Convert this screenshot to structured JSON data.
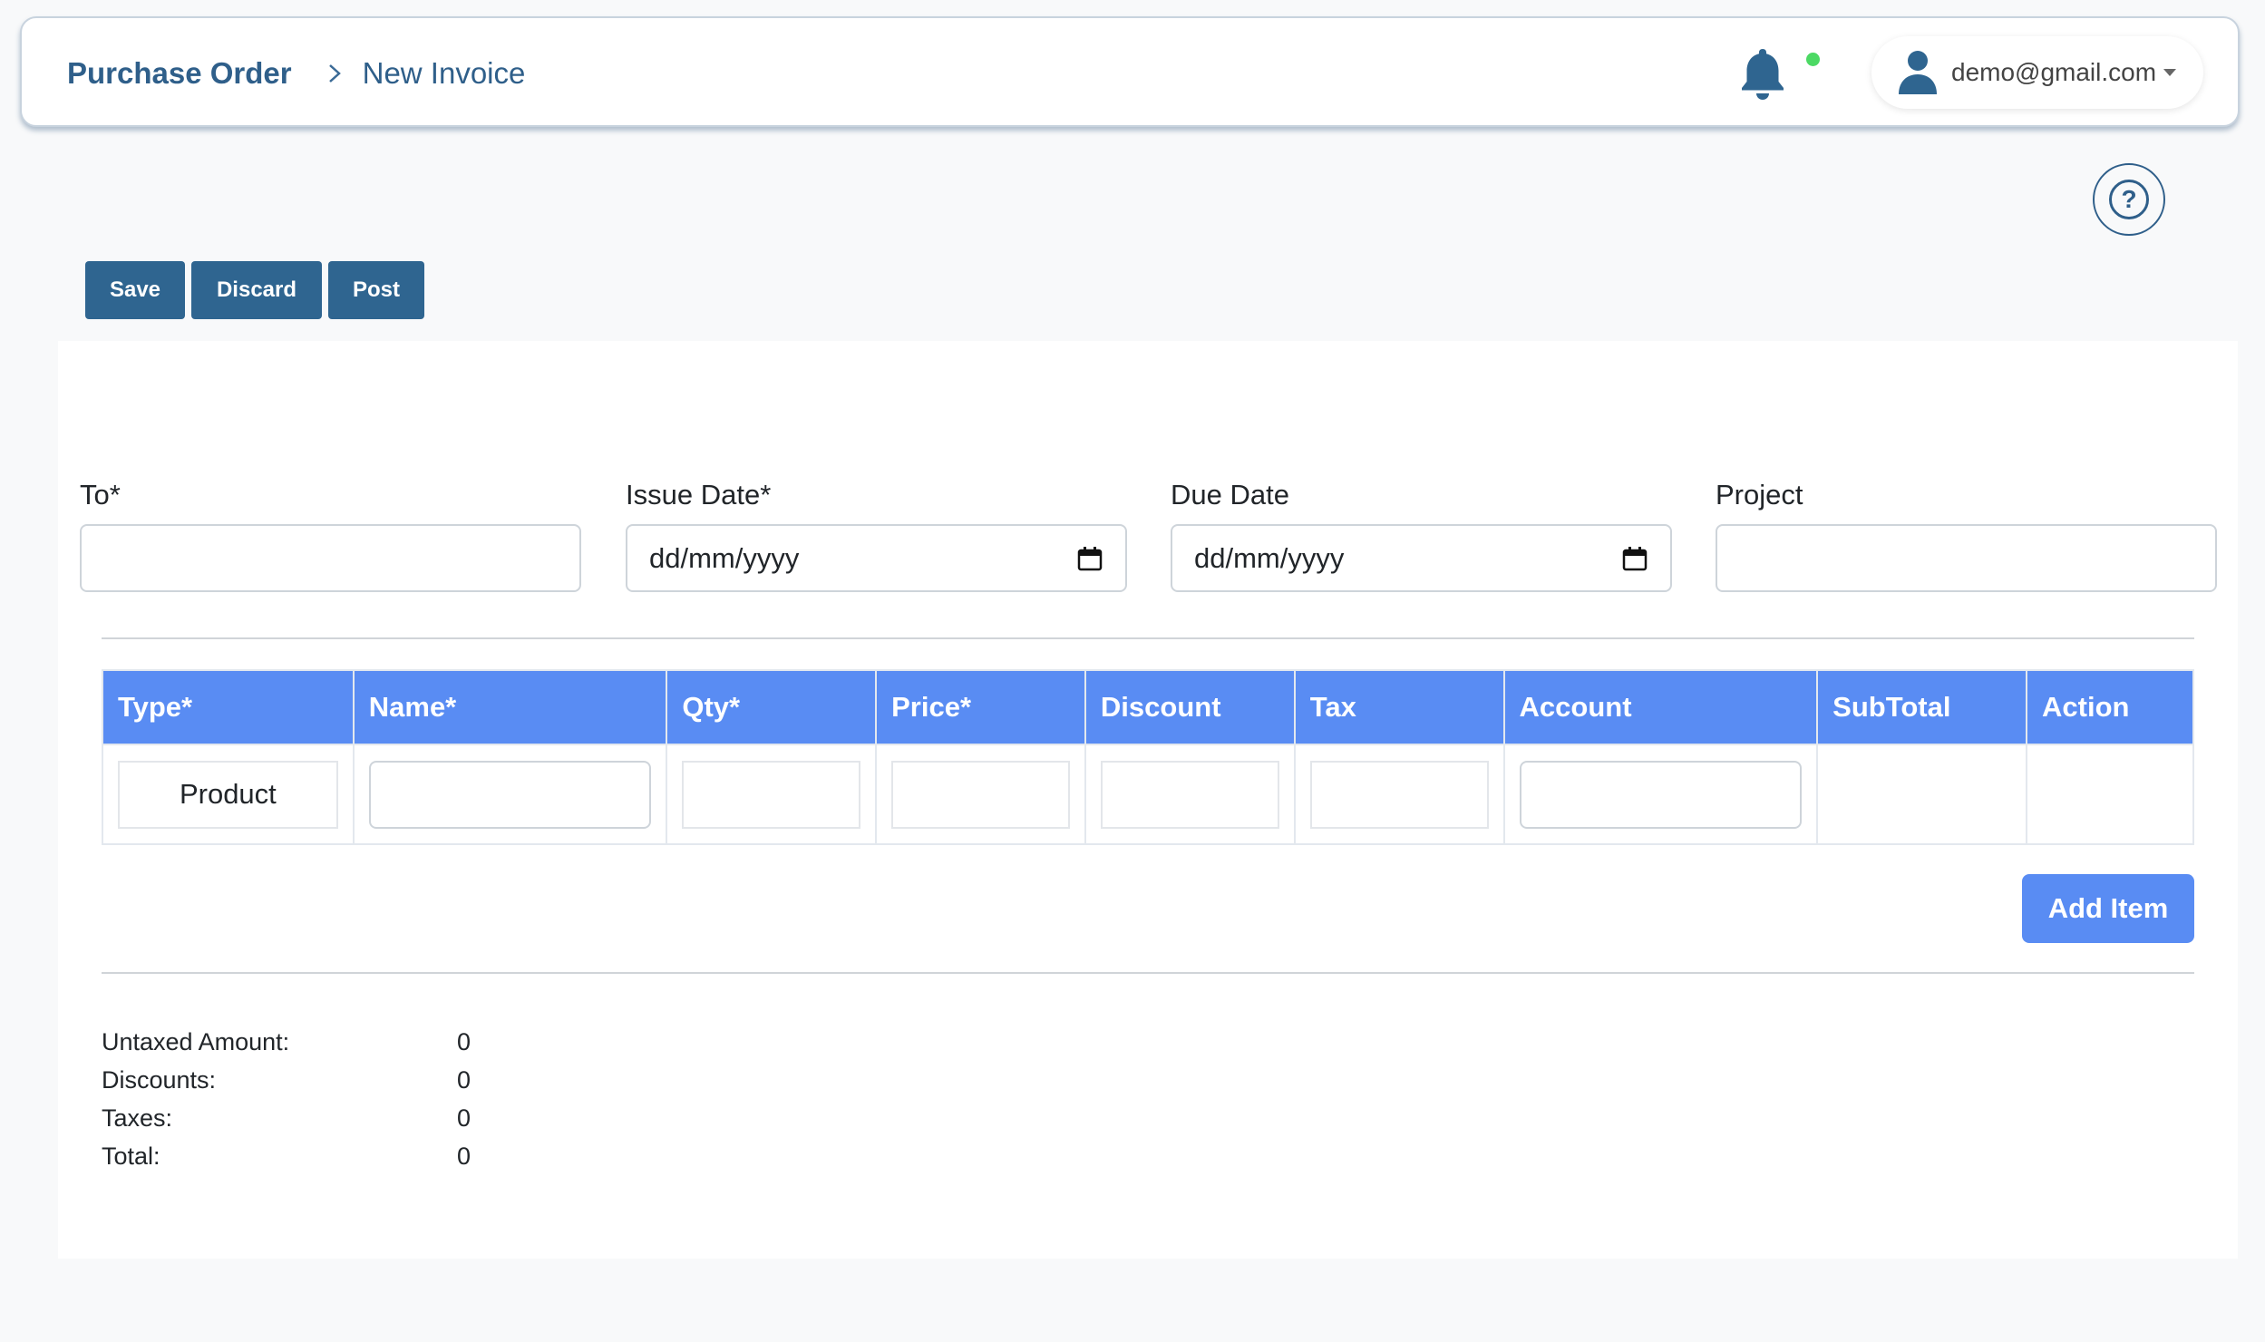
{
  "header": {
    "breadcrumb_root": "Purchase Order",
    "breadcrumb_current": "New Invoice",
    "user_email": "demo@gmail.com",
    "notification_dot_color": "#4cd964"
  },
  "help": {
    "symbol": "?"
  },
  "toolbar": {
    "save_label": "Save",
    "discard_label": "Discard",
    "post_label": "Post"
  },
  "form": {
    "to": {
      "label": "To*",
      "value": ""
    },
    "issue_date": {
      "label": "Issue Date*",
      "placeholder": "dd/mm/yyyy"
    },
    "due_date": {
      "label": "Due Date",
      "placeholder": "dd/mm/yyyy"
    },
    "project": {
      "label": "Project",
      "value": ""
    }
  },
  "table": {
    "columns": [
      "Type*",
      "Name*",
      "Qty*",
      "Price*",
      "Discount",
      "Tax",
      "Account",
      "SubTotal",
      "Action"
    ],
    "rows": [
      {
        "type": "Product",
        "name": "",
        "qty": "",
        "price": "",
        "discount": "",
        "tax": "",
        "account": "",
        "subtotal": "",
        "action": ""
      }
    ],
    "header_color": "#598cf3"
  },
  "add_item_label": "Add Item",
  "totals": [
    {
      "label": "Untaxed Amount:",
      "value": "0"
    },
    {
      "label": "Discounts:",
      "value": "0"
    },
    {
      "label": "Taxes:",
      "value": "0"
    },
    {
      "label": "Total:",
      "value": "0"
    }
  ],
  "colors": {
    "primary_dark": "#2f6590",
    "primary_light": "#598cf3"
  }
}
